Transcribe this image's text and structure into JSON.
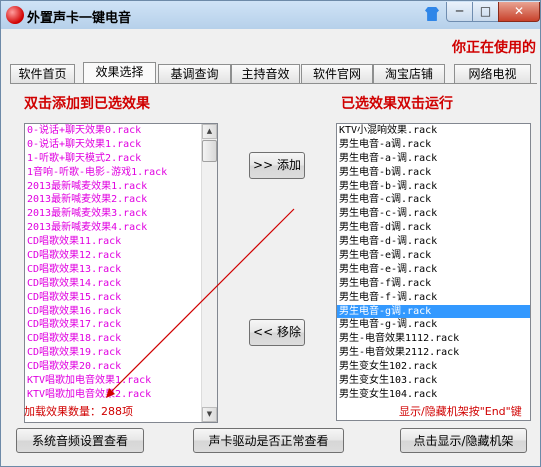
{
  "window": {
    "title": "外置声卡一键电音",
    "controls": {
      "minimize": "─",
      "maximize": "□",
      "close": "✕"
    }
  },
  "marquee": "你正在使用的",
  "tabs": [
    "软件首页",
    "效果选择",
    "基调查询",
    "主持音效",
    "软件官网",
    "淘宝店铺",
    "网络电视"
  ],
  "active_tab": "效果选择",
  "left_panel": {
    "heading": "双击添加到已选效果",
    "items": [
      "0-说话+聊天效果0.rack",
      "0-说话+聊天效果1.rack",
      "1-听歌+聊天模式2.rack",
      "1音响-听歌-电影-游戏1.rack",
      "2013最新喊麦效果1.rack",
      "2013最新喊麦效果2.rack",
      "2013最新喊麦效果3.rack",
      "2013最新喊麦效果4.rack",
      "CD唱歌效果11.rack",
      "CD唱歌效果12.rack",
      "CD唱歌效果13.rack",
      "CD唱歌效果14.rack",
      "CD唱歌效果15.rack",
      "CD唱歌效果16.rack",
      "CD唱歌效果17.rack",
      "CD唱歌效果18.rack",
      "CD唱歌效果19.rack",
      "CD唱歌效果20.rack",
      "KTV唱歌加电音效果1.rack",
      "KTV唱歌加电音效果2.rack"
    ],
    "count_label": "加载效果数量：288项"
  },
  "right_panel": {
    "heading": "已选效果双击运行",
    "items": [
      "KTV小混响效果.rack",
      "男生电音-a调.rack",
      "男生电音-a-调.rack",
      "男生电音-b调.rack",
      "男生电音-b-调.rack",
      "男生电音-c调.rack",
      "男生电音-c-调.rack",
      "男生电音-d调.rack",
      "男生电音-d-调.rack",
      "男生电音-e调.rack",
      "男生电音-e-调.rack",
      "男生电音-f调.rack",
      "男生电音-f-调.rack",
      "男生电音-g调.rack",
      "男生电音-g-调.rack",
      "男生-电音效果1112.rack",
      "男生-电音效果2112.rack",
      "男生变女生102.rack",
      "男生变女生103.rack",
      "男生变女生104.rack"
    ],
    "selected": "男生电音-g调.rack",
    "hint": "显示/隐藏机架按\"End\"键"
  },
  "buttons": {
    "add": ">> 添加",
    "remove": "<< 移除",
    "audio_settings": "系统音频设置查看",
    "driver_check": "声卡驱动是否正常查看",
    "toggle_rack": "点击显示/隐藏机架"
  },
  "colors": {
    "accent_red": "#d00000",
    "list_magenta": "#e000e0",
    "selection_blue": "#3399ff"
  }
}
